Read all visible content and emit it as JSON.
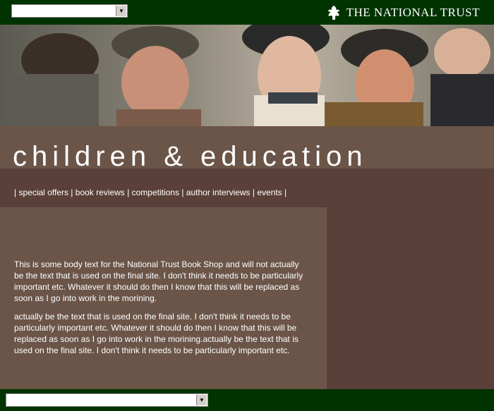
{
  "header": {
    "brand": "THE NATIONAL TRUST",
    "top_select_value": "",
    "logo_icon": "oak-leaf-icon"
  },
  "hero": {
    "image_icon": "children-photo"
  },
  "page": {
    "title": "children & education"
  },
  "nav": {
    "items": [
      "special offers",
      "book reviews",
      "competitions",
      "author interviews",
      "events"
    ],
    "separator": "|"
  },
  "content": {
    "paragraph1": "This is some body text for the National Trust Book Shop and will not actually be the text that is used on the final site.  I don't think it needs to be particularly important etc.  Whatever it should do then I know that this will be replaced as soon as I go into work in the morining.",
    "paragraph2": "actually be the text that is used on the final site.  I don't think it needs to be particularly important etc.  Whatever it should do then I know that this will be replaced as soon as I go into work in the morining.actually be the text that is used on the final site.  I don't think it needs to be particularly important etc."
  },
  "footer": {
    "bottom_select_value": ""
  },
  "colors": {
    "header_green": "#003300",
    "band_light": "#6b5548",
    "band_dark": "#5a4038",
    "text": "#ffffff"
  }
}
